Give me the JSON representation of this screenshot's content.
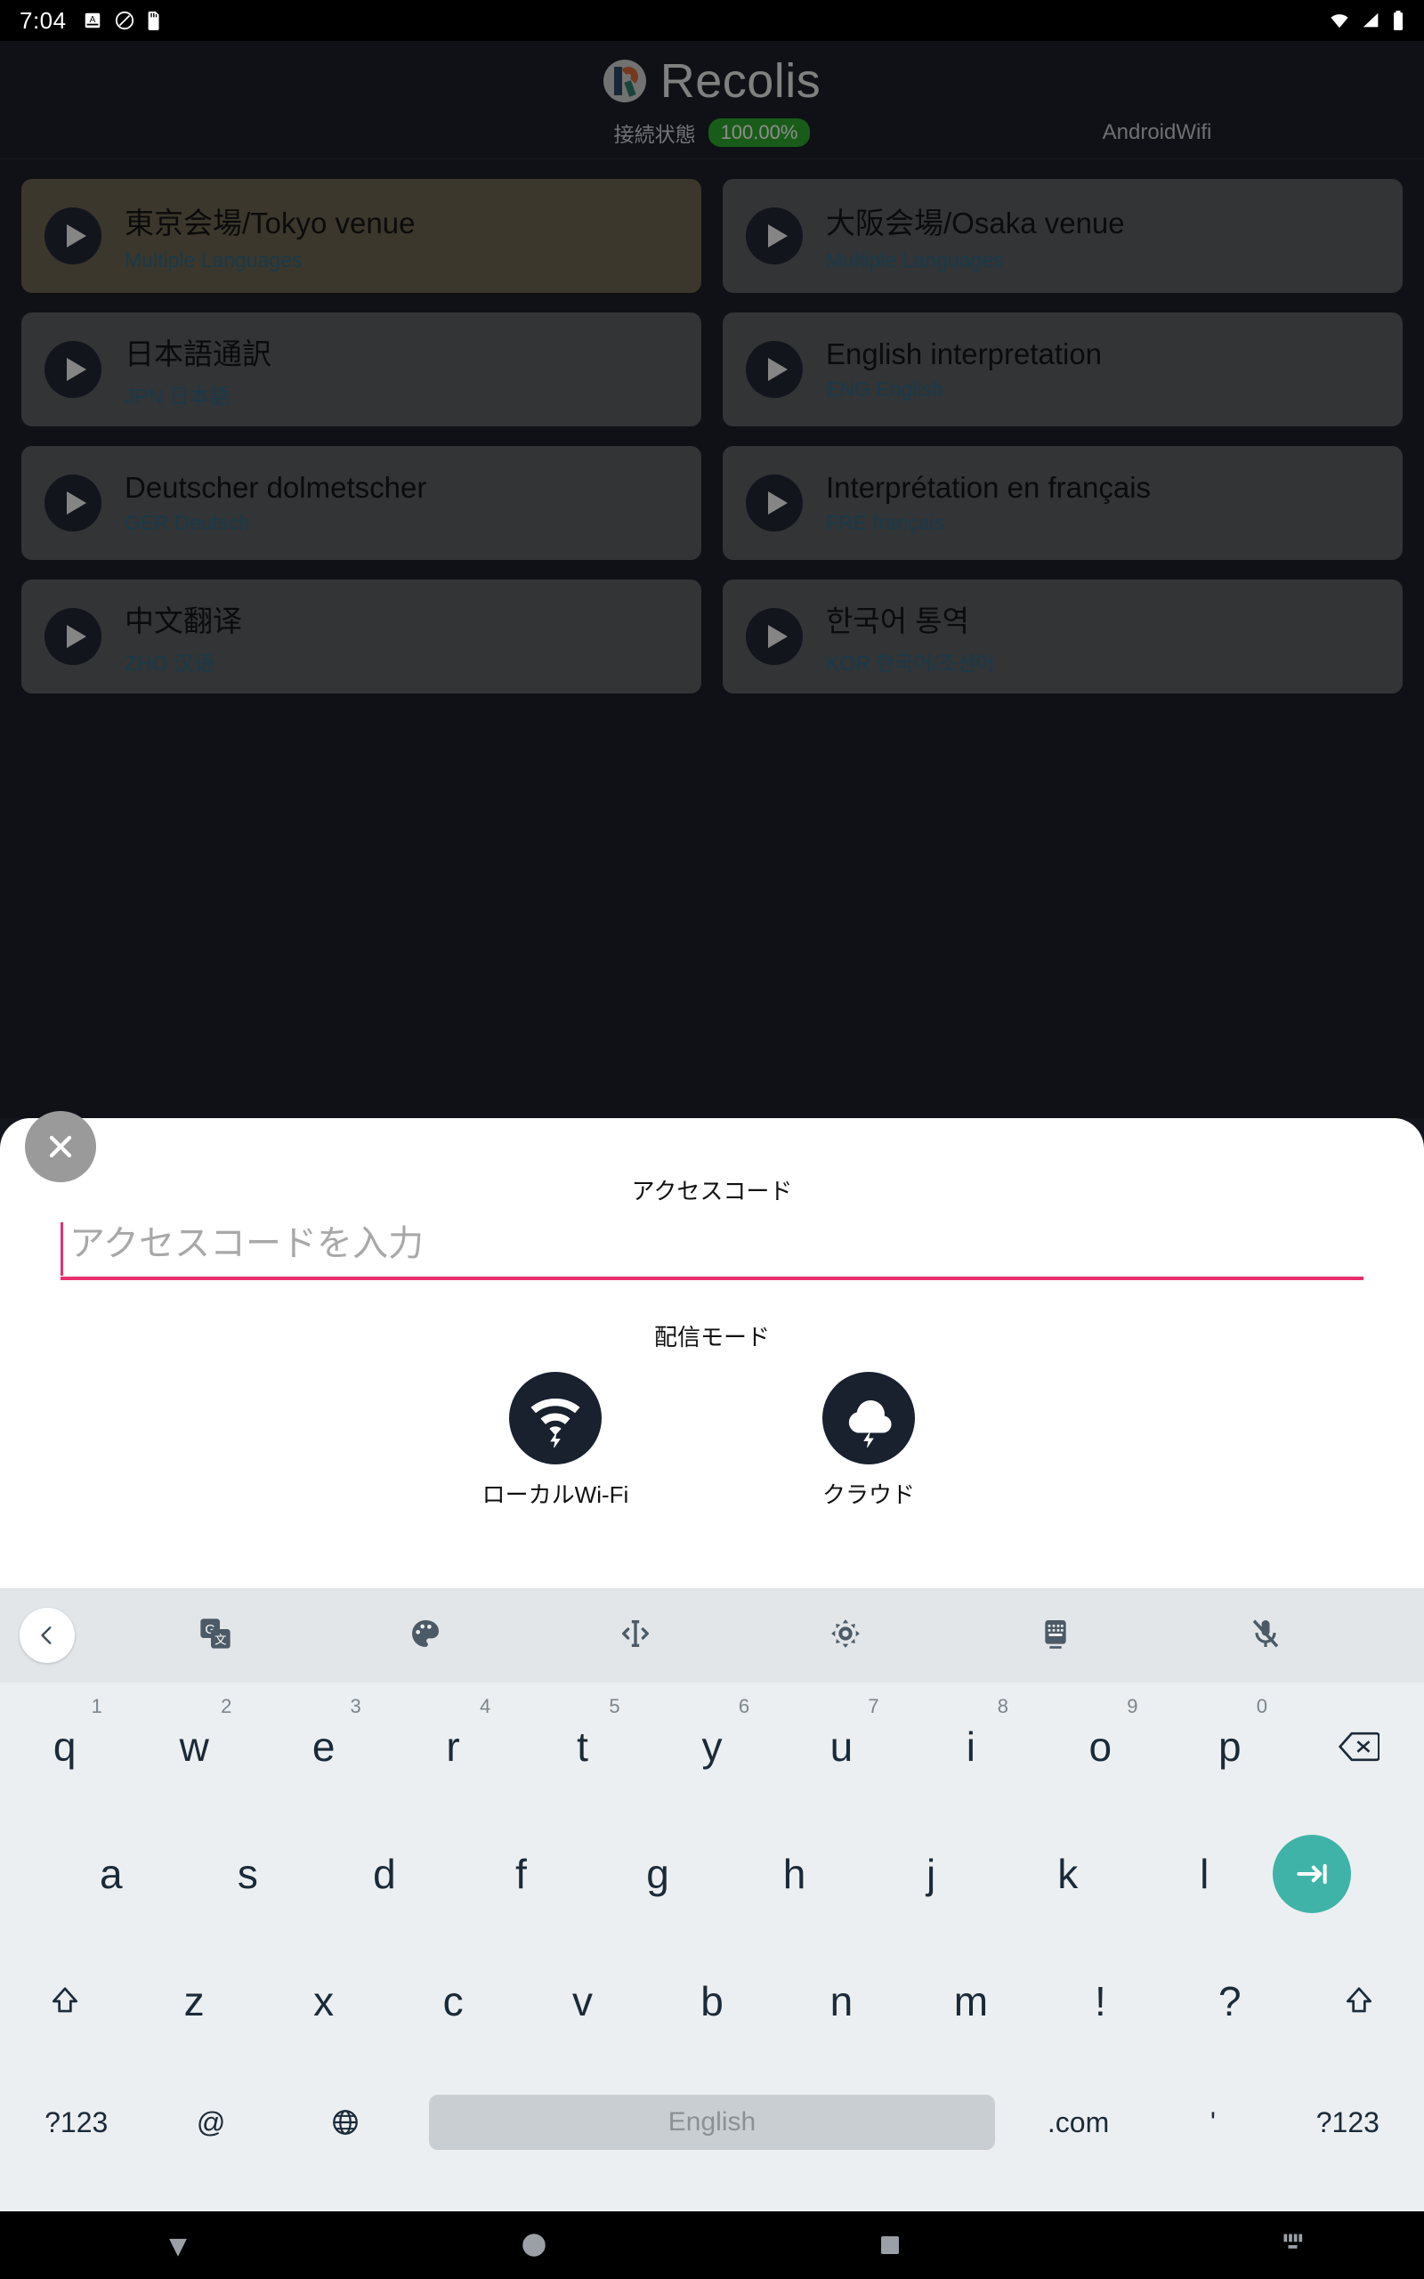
{
  "status_bar": {
    "time": "7:04",
    "left_icons": [
      "alarm-icon",
      "do-not-disturb-icon",
      "sd-card-icon"
    ],
    "right_icons": [
      "wifi-icon",
      "signal-icon",
      "battery-icon"
    ]
  },
  "app": {
    "brand_name": "Recolis",
    "connection_label": "接続状態",
    "connection_value": "100.00%",
    "connection_color": "#2fa82f",
    "ssid": "AndroidWifi",
    "channels": [
      {
        "title": "東京会場/Tokyo venue",
        "subtitle": "Multiple Languages",
        "selected": true
      },
      {
        "title": "大阪会場/Osaka venue",
        "subtitle": "Multiple Languages",
        "selected": false
      },
      {
        "title": "日本語通訳",
        "subtitle": "JPN 日本語",
        "selected": false
      },
      {
        "title": "English interpretation",
        "subtitle": "ENG English",
        "selected": false
      },
      {
        "title": "Deutscher dolmetscher",
        "subtitle": "GER Deutsch",
        "selected": false
      },
      {
        "title": "Interprétation en français",
        "subtitle": "FRE français",
        "selected": false
      },
      {
        "title": "中文翻译",
        "subtitle": "ZHO 汉语",
        "selected": false
      },
      {
        "title": "한국어 통역",
        "subtitle": "KOR 한국어/조선어",
        "selected": false
      }
    ]
  },
  "sheet": {
    "close_label": "×",
    "title": "アクセスコード",
    "input_value": "",
    "input_placeholder": "アクセスコードを入力",
    "accent_color": "#e8306d",
    "mode_title": "配信モード",
    "modes": [
      {
        "icon": "wifi-bolt-icon",
        "label": "ローカルWi-Fi"
      },
      {
        "icon": "cloud-bolt-icon",
        "label": "クラウド"
      }
    ]
  },
  "keyboard": {
    "toolbar_icons": [
      "chevron-left-icon",
      "translate-icon",
      "palette-icon",
      "text-cursor-icon",
      "gear-icon",
      "keyboard-icon",
      "mic-off-icon"
    ],
    "row1": [
      {
        "key": "q",
        "num": "1"
      },
      {
        "key": "w",
        "num": "2"
      },
      {
        "key": "e",
        "num": "3"
      },
      {
        "key": "r",
        "num": "4"
      },
      {
        "key": "t",
        "num": "5"
      },
      {
        "key": "y",
        "num": "6"
      },
      {
        "key": "u",
        "num": "7"
      },
      {
        "key": "i",
        "num": "8"
      },
      {
        "key": "o",
        "num": "9"
      },
      {
        "key": "p",
        "num": "0"
      }
    ],
    "row1_action": "backspace-icon",
    "row2": [
      "a",
      "s",
      "d",
      "f",
      "g",
      "h",
      "j",
      "k",
      "l"
    ],
    "row2_action": "enter-icon",
    "row3": [
      "z",
      "x",
      "c",
      "v",
      "b",
      "n",
      "m",
      "!",
      "?"
    ],
    "row3_left_action": "shift-icon",
    "row3_right_action": "shift-icon",
    "row4": {
      "symbols_left": "?123",
      "at": "@",
      "globe": "globe-icon",
      "space_label": "English",
      "dotcom": ".com",
      "apostrophe": "'",
      "symbols_right": "?123"
    },
    "enter_color": "#3fb3a8"
  },
  "nav_bar": {
    "items": [
      "back-triangle-icon",
      "home-circle-icon",
      "recents-square-icon",
      "keyboard-indicator-icon"
    ]
  }
}
